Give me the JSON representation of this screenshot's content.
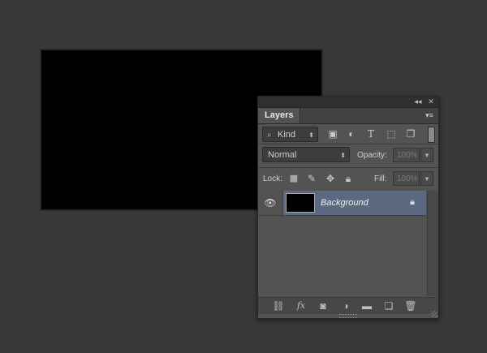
{
  "panel": {
    "collapse_icon": "◂◂",
    "close_icon": "✕",
    "tab_label": "Layers",
    "menu_icon": "▾≡"
  },
  "filter": {
    "kind_label": "Kind",
    "icons": [
      "pixel-filter-icon",
      "adjustment-filter-icon",
      "type-filter-icon",
      "shape-filter-icon",
      "smart-object-filter-icon"
    ]
  },
  "blend": {
    "mode": "Normal",
    "opacity_label": "Opacity:",
    "opacity_value": "100%"
  },
  "lock": {
    "label": "Lock:",
    "fill_label": "Fill:",
    "fill_value": "100%"
  },
  "layers": [
    {
      "name": "Background",
      "visible": true,
      "locked": true,
      "selected": true
    }
  ],
  "bottom_icons": [
    "link-icon",
    "fx-icon",
    "mask-icon",
    "adjustment-icon",
    "folder-icon",
    "new-layer-icon",
    "trash-icon"
  ],
  "colors": {
    "selection": "#5b6a80",
    "panel_bg": "#535353",
    "workspace": "#383838"
  }
}
